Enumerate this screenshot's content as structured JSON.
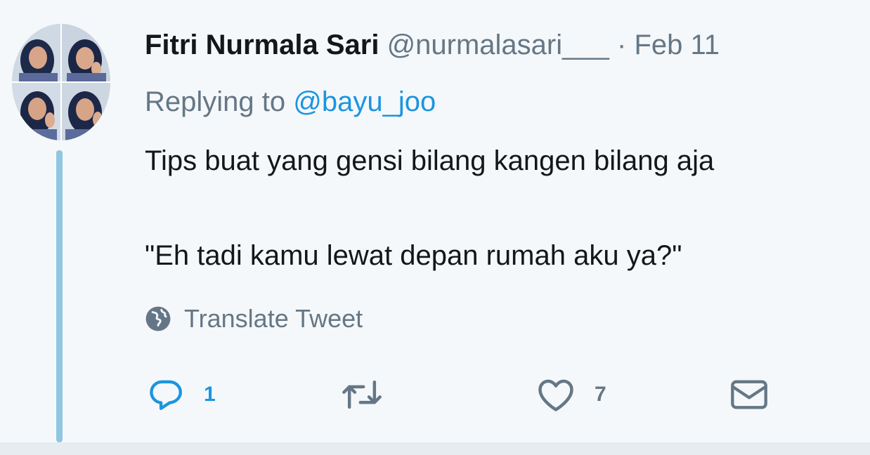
{
  "tweet": {
    "author_name": "Fitri Nurmala Sari",
    "author_handle": "@nurmalasari___",
    "separator": "·",
    "date": "Feb 11",
    "replying_prefix": "Replying to",
    "replying_to": "@bayu_joo",
    "text_line_1": "Tips buat yang gensi bilang kangen bilang aja",
    "text_line_2": "\"Eh tadi kamu lewat depan rumah aku ya?\"",
    "translate_label": "Translate Tweet"
  },
  "actions": {
    "reply_count": "1",
    "like_count": "7"
  },
  "colors": {
    "background": "#f5f8fa",
    "accent_blue": "#1b95e0",
    "muted_gray": "#657786",
    "thread_line": "#8fc7e0"
  },
  "icons": {
    "avatar": "avatar-photo-collage",
    "translate": "globe-icon",
    "reply": "reply-bubble-icon",
    "retweet": "retweet-icon",
    "like": "heart-icon",
    "dm": "envelope-icon"
  }
}
